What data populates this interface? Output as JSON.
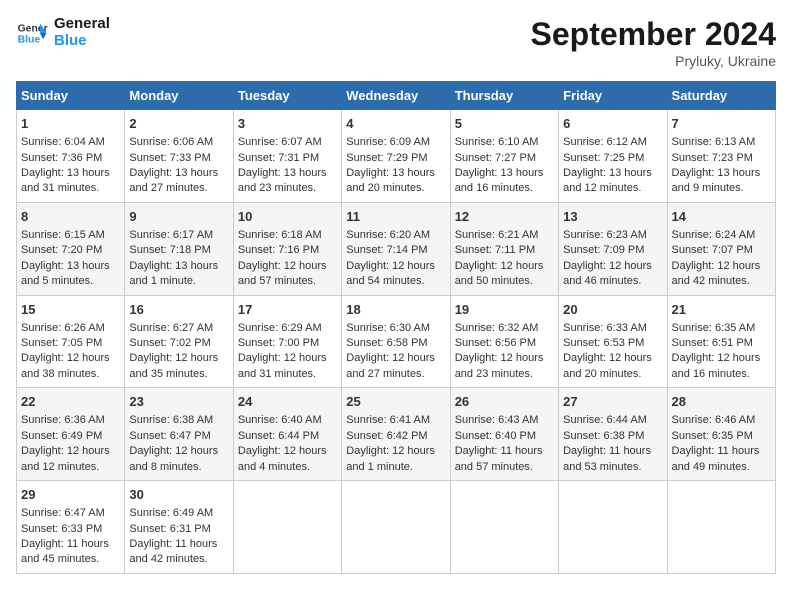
{
  "header": {
    "logo_line1": "General",
    "logo_line2": "Blue",
    "month": "September 2024",
    "location": "Pryluky, Ukraine"
  },
  "weekdays": [
    "Sunday",
    "Monday",
    "Tuesday",
    "Wednesday",
    "Thursday",
    "Friday",
    "Saturday"
  ],
  "weeks": [
    [
      {
        "day": "1",
        "lines": [
          "Sunrise: 6:04 AM",
          "Sunset: 7:36 PM",
          "Daylight: 13 hours",
          "and 31 minutes."
        ]
      },
      {
        "day": "2",
        "lines": [
          "Sunrise: 6:06 AM",
          "Sunset: 7:33 PM",
          "Daylight: 13 hours",
          "and 27 minutes."
        ]
      },
      {
        "day": "3",
        "lines": [
          "Sunrise: 6:07 AM",
          "Sunset: 7:31 PM",
          "Daylight: 13 hours",
          "and 23 minutes."
        ]
      },
      {
        "day": "4",
        "lines": [
          "Sunrise: 6:09 AM",
          "Sunset: 7:29 PM",
          "Daylight: 13 hours",
          "and 20 minutes."
        ]
      },
      {
        "day": "5",
        "lines": [
          "Sunrise: 6:10 AM",
          "Sunset: 7:27 PM",
          "Daylight: 13 hours",
          "and 16 minutes."
        ]
      },
      {
        "day": "6",
        "lines": [
          "Sunrise: 6:12 AM",
          "Sunset: 7:25 PM",
          "Daylight: 13 hours",
          "and 12 minutes."
        ]
      },
      {
        "day": "7",
        "lines": [
          "Sunrise: 6:13 AM",
          "Sunset: 7:23 PM",
          "Daylight: 13 hours",
          "and 9 minutes."
        ]
      }
    ],
    [
      {
        "day": "8",
        "lines": [
          "Sunrise: 6:15 AM",
          "Sunset: 7:20 PM",
          "Daylight: 13 hours",
          "and 5 minutes."
        ]
      },
      {
        "day": "9",
        "lines": [
          "Sunrise: 6:17 AM",
          "Sunset: 7:18 PM",
          "Daylight: 13 hours",
          "and 1 minute."
        ]
      },
      {
        "day": "10",
        "lines": [
          "Sunrise: 6:18 AM",
          "Sunset: 7:16 PM",
          "Daylight: 12 hours",
          "and 57 minutes."
        ]
      },
      {
        "day": "11",
        "lines": [
          "Sunrise: 6:20 AM",
          "Sunset: 7:14 PM",
          "Daylight: 12 hours",
          "and 54 minutes."
        ]
      },
      {
        "day": "12",
        "lines": [
          "Sunrise: 6:21 AM",
          "Sunset: 7:11 PM",
          "Daylight: 12 hours",
          "and 50 minutes."
        ]
      },
      {
        "day": "13",
        "lines": [
          "Sunrise: 6:23 AM",
          "Sunset: 7:09 PM",
          "Daylight: 12 hours",
          "and 46 minutes."
        ]
      },
      {
        "day": "14",
        "lines": [
          "Sunrise: 6:24 AM",
          "Sunset: 7:07 PM",
          "Daylight: 12 hours",
          "and 42 minutes."
        ]
      }
    ],
    [
      {
        "day": "15",
        "lines": [
          "Sunrise: 6:26 AM",
          "Sunset: 7:05 PM",
          "Daylight: 12 hours",
          "and 38 minutes."
        ]
      },
      {
        "day": "16",
        "lines": [
          "Sunrise: 6:27 AM",
          "Sunset: 7:02 PM",
          "Daylight: 12 hours",
          "and 35 minutes."
        ]
      },
      {
        "day": "17",
        "lines": [
          "Sunrise: 6:29 AM",
          "Sunset: 7:00 PM",
          "Daylight: 12 hours",
          "and 31 minutes."
        ]
      },
      {
        "day": "18",
        "lines": [
          "Sunrise: 6:30 AM",
          "Sunset: 6:58 PM",
          "Daylight: 12 hours",
          "and 27 minutes."
        ]
      },
      {
        "day": "19",
        "lines": [
          "Sunrise: 6:32 AM",
          "Sunset: 6:56 PM",
          "Daylight: 12 hours",
          "and 23 minutes."
        ]
      },
      {
        "day": "20",
        "lines": [
          "Sunrise: 6:33 AM",
          "Sunset: 6:53 PM",
          "Daylight: 12 hours",
          "and 20 minutes."
        ]
      },
      {
        "day": "21",
        "lines": [
          "Sunrise: 6:35 AM",
          "Sunset: 6:51 PM",
          "Daylight: 12 hours",
          "and 16 minutes."
        ]
      }
    ],
    [
      {
        "day": "22",
        "lines": [
          "Sunrise: 6:36 AM",
          "Sunset: 6:49 PM",
          "Daylight: 12 hours",
          "and 12 minutes."
        ]
      },
      {
        "day": "23",
        "lines": [
          "Sunrise: 6:38 AM",
          "Sunset: 6:47 PM",
          "Daylight: 12 hours",
          "and 8 minutes."
        ]
      },
      {
        "day": "24",
        "lines": [
          "Sunrise: 6:40 AM",
          "Sunset: 6:44 PM",
          "Daylight: 12 hours",
          "and 4 minutes."
        ]
      },
      {
        "day": "25",
        "lines": [
          "Sunrise: 6:41 AM",
          "Sunset: 6:42 PM",
          "Daylight: 12 hours",
          "and 1 minute."
        ]
      },
      {
        "day": "26",
        "lines": [
          "Sunrise: 6:43 AM",
          "Sunset: 6:40 PM",
          "Daylight: 11 hours",
          "and 57 minutes."
        ]
      },
      {
        "day": "27",
        "lines": [
          "Sunrise: 6:44 AM",
          "Sunset: 6:38 PM",
          "Daylight: 11 hours",
          "and 53 minutes."
        ]
      },
      {
        "day": "28",
        "lines": [
          "Sunrise: 6:46 AM",
          "Sunset: 6:35 PM",
          "Daylight: 11 hours",
          "and 49 minutes."
        ]
      }
    ],
    [
      {
        "day": "29",
        "lines": [
          "Sunrise: 6:47 AM",
          "Sunset: 6:33 PM",
          "Daylight: 11 hours",
          "and 45 minutes."
        ]
      },
      {
        "day": "30",
        "lines": [
          "Sunrise: 6:49 AM",
          "Sunset: 6:31 PM",
          "Daylight: 11 hours",
          "and 42 minutes."
        ]
      },
      {
        "day": "",
        "lines": []
      },
      {
        "day": "",
        "lines": []
      },
      {
        "day": "",
        "lines": []
      },
      {
        "day": "",
        "lines": []
      },
      {
        "day": "",
        "lines": []
      }
    ]
  ]
}
